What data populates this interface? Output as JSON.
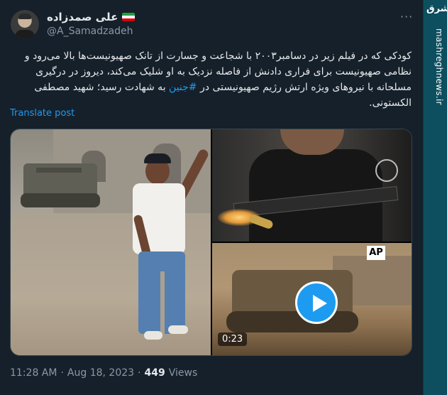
{
  "author": {
    "name": "علی صمدزاده",
    "handle": "@A_Samadzadeh",
    "flag_icon": "iran-flag-icon"
  },
  "more_icon": "···",
  "tweet": {
    "text_before": "کودکی که در فیلم زیر در دسامبر۲۰۰۳ با شجاعت و جسارت از تانک صهیونیست‌ها بالا می‌رود و نظامی صهیونیست برای فراری دادنش از فاصله نزدیک به او شلیک می‌کند، دیروز در درگیری مسلحانه با نیروهای ویژه ارتش رژیم صهیونیستی در",
    "hashtag": "#جنین",
    "text_after": "به شهادت رسید؛ شهید مصطفی الکستونی."
  },
  "translate_label": "Translate post",
  "media": {
    "ap_badge": "AP",
    "duration": "0:23"
  },
  "meta": {
    "time": "11:28 AM",
    "dot1": "·",
    "date": "Aug 18, 2023",
    "dot2": "·",
    "views_count": "449",
    "views_label": "Views"
  },
  "side": {
    "logo": "مشرق",
    "url": "mashreghnews.ir"
  },
  "colors": {
    "background": "#15202b",
    "link": "#1d9bf0",
    "muted": "#8b98a5",
    "side_strip": "#0d4f5f"
  }
}
